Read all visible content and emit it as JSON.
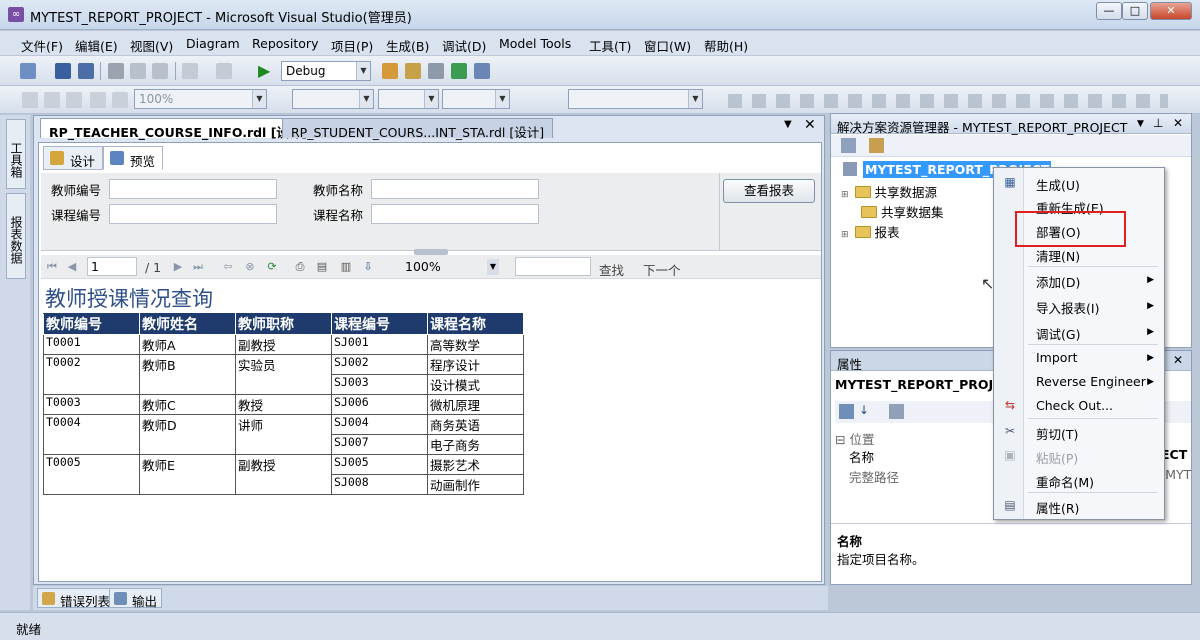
{
  "window": {
    "title": "MYTEST_REPORT_PROJECT - Microsoft Visual Studio(管理员)",
    "min": "—",
    "max": "□",
    "close": "✕"
  },
  "menu": [
    "文件(F)",
    "编辑(E)",
    "视图(V)",
    "Diagram",
    "Repository",
    "项目(P)",
    "生成(B)",
    "调试(D)",
    "Model Tools",
    "工具(T)",
    "窗口(W)",
    "帮助(H)"
  ],
  "toolbar": {
    "config": "Debug",
    "zoom": "100%"
  },
  "left_tabs": {
    "toolbox": "工具箱",
    "report_data": "报表数据"
  },
  "doc_tabs": {
    "active": "RP_TEACHER_COURSE_INFO.rdl [设计]",
    "inactive": "RP_STUDENT_COURS...INT_STA.rdl [设计]",
    "close": "✕",
    "pin": "▼"
  },
  "sub_tabs": {
    "design": "设计",
    "preview": "预览"
  },
  "params": {
    "teacher_no": "教师编号",
    "teacher_name": "教师名称",
    "course_no": "课程编号",
    "course_name": "课程名称",
    "view_report": "查看报表"
  },
  "viewer": {
    "page": "1",
    "of": "/ 1",
    "zoom": "100%",
    "find": "查找",
    "next": "下一个"
  },
  "report": {
    "title": "教师授课情况查询",
    "headers": [
      "教师编号",
      "教师姓名",
      "教师职称",
      "课程编号",
      "课程名称"
    ],
    "rows": [
      {
        "tid": "T0001",
        "tname": "教师A",
        "rank": "副教授",
        "courses": [
          [
            "SJ001",
            "高等数学"
          ]
        ]
      },
      {
        "tid": "T0002",
        "tname": "教师B",
        "rank": "实验员",
        "courses": [
          [
            "SJ002",
            "程序设计"
          ],
          [
            "SJ003",
            "设计模式"
          ]
        ]
      },
      {
        "tid": "T0003",
        "tname": "教师C",
        "rank": "教授",
        "courses": [
          [
            "SJ006",
            "微机原理"
          ]
        ]
      },
      {
        "tid": "T0004",
        "tname": "教师D",
        "rank": "讲师",
        "courses": [
          [
            "SJ004",
            "商务英语"
          ],
          [
            "SJ007",
            "电子商务"
          ]
        ]
      },
      {
        "tid": "T0005",
        "tname": "教师E",
        "rank": "副教授",
        "courses": [
          [
            "SJ005",
            "摄影艺术"
          ],
          [
            "SJ008",
            "动画制作"
          ]
        ]
      }
    ]
  },
  "bottom_tabs": {
    "errors": "错误列表",
    "output": "输出"
  },
  "status": "就绪",
  "solution": {
    "header": "解决方案资源管理器 - MYTEST_REPORT_PROJECT",
    "project": "MYTEST_REPORT_PROJECT",
    "items": [
      "共享数据源",
      "共享数据集",
      "报表"
    ]
  },
  "properties": {
    "header": "属性",
    "object": "MYTEST_REPORT_PROJEC",
    "section": "位置",
    "rows": [
      [
        "名称",
        "ECT"
      ],
      [
        "完整路径",
        "\\MYT"
      ]
    ],
    "desc_title": "名称",
    "desc_text": "指定项目名称。"
  },
  "context_menu": [
    {
      "label": "生成(U)"
    },
    {
      "label": "重新生成(E)"
    },
    {
      "label": "部署(O)",
      "highlighted": true
    },
    {
      "label": "清理(N)"
    },
    {
      "label": "添加(D)",
      "submenu": true
    },
    {
      "label": "导入报表(I)",
      "submenu": true
    },
    {
      "label": "调试(G)",
      "submenu": true
    },
    {
      "label": "Import",
      "submenu": true
    },
    {
      "label": "Reverse Engineer",
      "submenu": true
    },
    {
      "label": "Check Out..."
    },
    {
      "label": "剪切(T)"
    },
    {
      "label": "粘贴(P)",
      "disabled": true
    },
    {
      "label": "重命名(M)"
    },
    {
      "label": "属性(R)"
    }
  ],
  "colors": {
    "highlight_box": "#e02020",
    "table_header": "#1f3b6e",
    "report_title": "#2e4f8a",
    "selection": "#3399ff"
  }
}
